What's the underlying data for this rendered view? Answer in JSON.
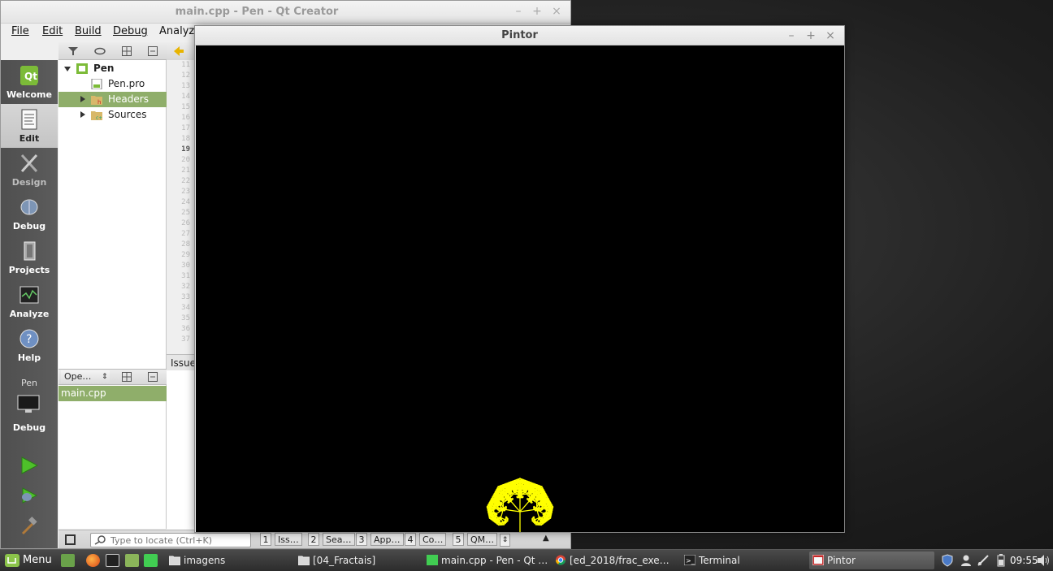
{
  "qt_creator": {
    "title": "main.cpp - Pen - Qt Creator",
    "menu": [
      "File",
      "Edit",
      "Build",
      "Debug",
      "Analyze"
    ],
    "modes": [
      {
        "label": "Welcome",
        "icon": "qt-logo-icon"
      },
      {
        "label": "Edit",
        "icon": "document-icon"
      },
      {
        "label": "Design",
        "icon": "design-tools-icon"
      },
      {
        "label": "Debug",
        "icon": "bug-icon"
      },
      {
        "label": "Projects",
        "icon": "wrench-book-icon"
      },
      {
        "label": "Analyze",
        "icon": "oscilloscope-icon"
      },
      {
        "label": "Help",
        "icon": "help-icon"
      }
    ],
    "kit": {
      "project": "Pen",
      "config": "Debug"
    },
    "project_tree": [
      {
        "label": "Pen",
        "expanded": true,
        "level": 0,
        "icon": "qt-project-icon"
      },
      {
        "label": "Pen.pro",
        "level": 1,
        "icon": "pro-file-icon"
      },
      {
        "label": "Headers",
        "level": 1,
        "icon": "headers-folder-icon",
        "selected": true
      },
      {
        "label": "Sources",
        "level": 1,
        "icon": "sources-folder-icon"
      }
    ],
    "open_docs_label": "Ope…",
    "open_docs": [
      "main.cpp"
    ],
    "line_numbers": [
      "11",
      "12",
      "13",
      "14",
      "15",
      "16",
      "17",
      "18",
      "19",
      "20",
      "21",
      "22",
      "23",
      "24",
      "25",
      "26",
      "27",
      "28",
      "29",
      "30",
      "31",
      "32",
      "33",
      "34",
      "35",
      "36",
      "37"
    ],
    "current_line": "19",
    "issues_tab": "Issue",
    "locator_placeholder": "Type to locate (Ctrl+K)",
    "output_panes": [
      {
        "num": "1",
        "name": "Iss…"
      },
      {
        "num": "2",
        "name": "Sea…"
      },
      {
        "num": "3",
        "name": "App…"
      },
      {
        "num": "4",
        "name": "Co…"
      },
      {
        "num": "5",
        "name": "QM…"
      }
    ]
  },
  "pintor": {
    "title": "Pintor",
    "fractal_color": "#ffff00",
    "background_color": "#000000"
  },
  "taskbar": {
    "menu_label": "Menu",
    "tasks": [
      {
        "label": "imagens",
        "icon": "folder-icon"
      },
      {
        "label": "[04_Fractais]",
        "icon": "folder-icon"
      },
      {
        "label": "main.cpp - Pen - Qt …",
        "icon": "qt-icon"
      },
      {
        "label": "[ed_2018/frac_exe…",
        "icon": "chrome-icon"
      },
      {
        "label": "Terminal",
        "icon": "terminal-icon"
      },
      {
        "label": "Pintor",
        "icon": "app-window-icon",
        "active": true
      }
    ],
    "clock": "09:55"
  }
}
